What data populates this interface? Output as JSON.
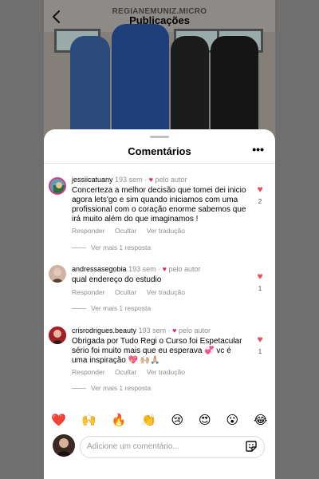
{
  "header": {
    "username": "REGIANEMUNIZ.MICRO",
    "title": "Publicações"
  },
  "sheet": {
    "title": "Comentários"
  },
  "comments": [
    {
      "username": "jessiicatuany",
      "time": "193 sem",
      "author_badge": "pelo autor",
      "text": "Concerteza a melhor decisão que tomei dei inicio agora lets'go e sim quando iniciamos com uma profissional com o coração enorme sabemos que irá muito além do que imaginamos !",
      "actions": [
        "Responder",
        "Ocultar",
        "Ver tradução"
      ],
      "replies": "Ver mais 1 resposta",
      "likes": "2"
    },
    {
      "username": "andressasegobia",
      "time": "193 sem",
      "author_badge": "pelo autor",
      "text": "qual endereço do estudio",
      "actions": [
        "Responder",
        "Ocultar",
        "Ver tradução"
      ],
      "replies": "Ver mais 1 resposta",
      "likes": "1"
    },
    {
      "username": "crisrodrigues.beauty",
      "time": "193 sem",
      "author_badge": "pelo autor",
      "text": "Obrigada por Tudo Regi o Curso foi Espetacular sério foi muito mais que eu esperava 💞 vc é uma inspiração 💖 🙌🏼🙏🏼",
      "actions": [
        "Responder",
        "Ocultar",
        "Ver tradução"
      ],
      "replies": "Ver mais 1 resposta",
      "likes": "1"
    }
  ],
  "emoji_bar": [
    "❤️",
    "🙌",
    "🔥",
    "👏",
    "😢",
    "😍",
    "😮",
    "😂"
  ],
  "composer": {
    "placeholder": "Adicione um comentário..."
  },
  "colors": {
    "like_red": "#ed4956",
    "muted_text": "#8e8e8e"
  }
}
